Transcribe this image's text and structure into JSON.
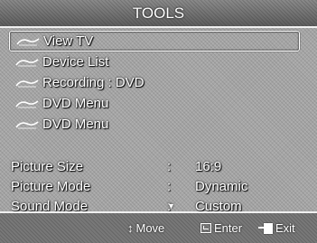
{
  "title": "TOOLS",
  "menu": [
    {
      "label": "View TV",
      "icon": "anynet-icon",
      "selected": true
    },
    {
      "label": "Device List",
      "icon": "anynet-icon",
      "selected": false
    },
    {
      "label": "Recording : DVD",
      "icon": "anynet-icon",
      "selected": false
    },
    {
      "label": "DVD Menu",
      "icon": "anynet-icon",
      "selected": false
    },
    {
      "label": "DVD Menu",
      "icon": "anynet-icon",
      "selected": false
    }
  ],
  "settings": [
    {
      "label": "Picture Size",
      "colon": ":",
      "value": "16:9"
    },
    {
      "label": "Picture Mode",
      "colon": ":",
      "value": "Dynamic"
    },
    {
      "label": "Sound Mode",
      "colon": ":",
      "value": "Custom"
    }
  ],
  "footer": {
    "move_icon": "↕",
    "move": "Move",
    "enter": "Enter",
    "exit": "Exit"
  },
  "more_indicator": "▼"
}
